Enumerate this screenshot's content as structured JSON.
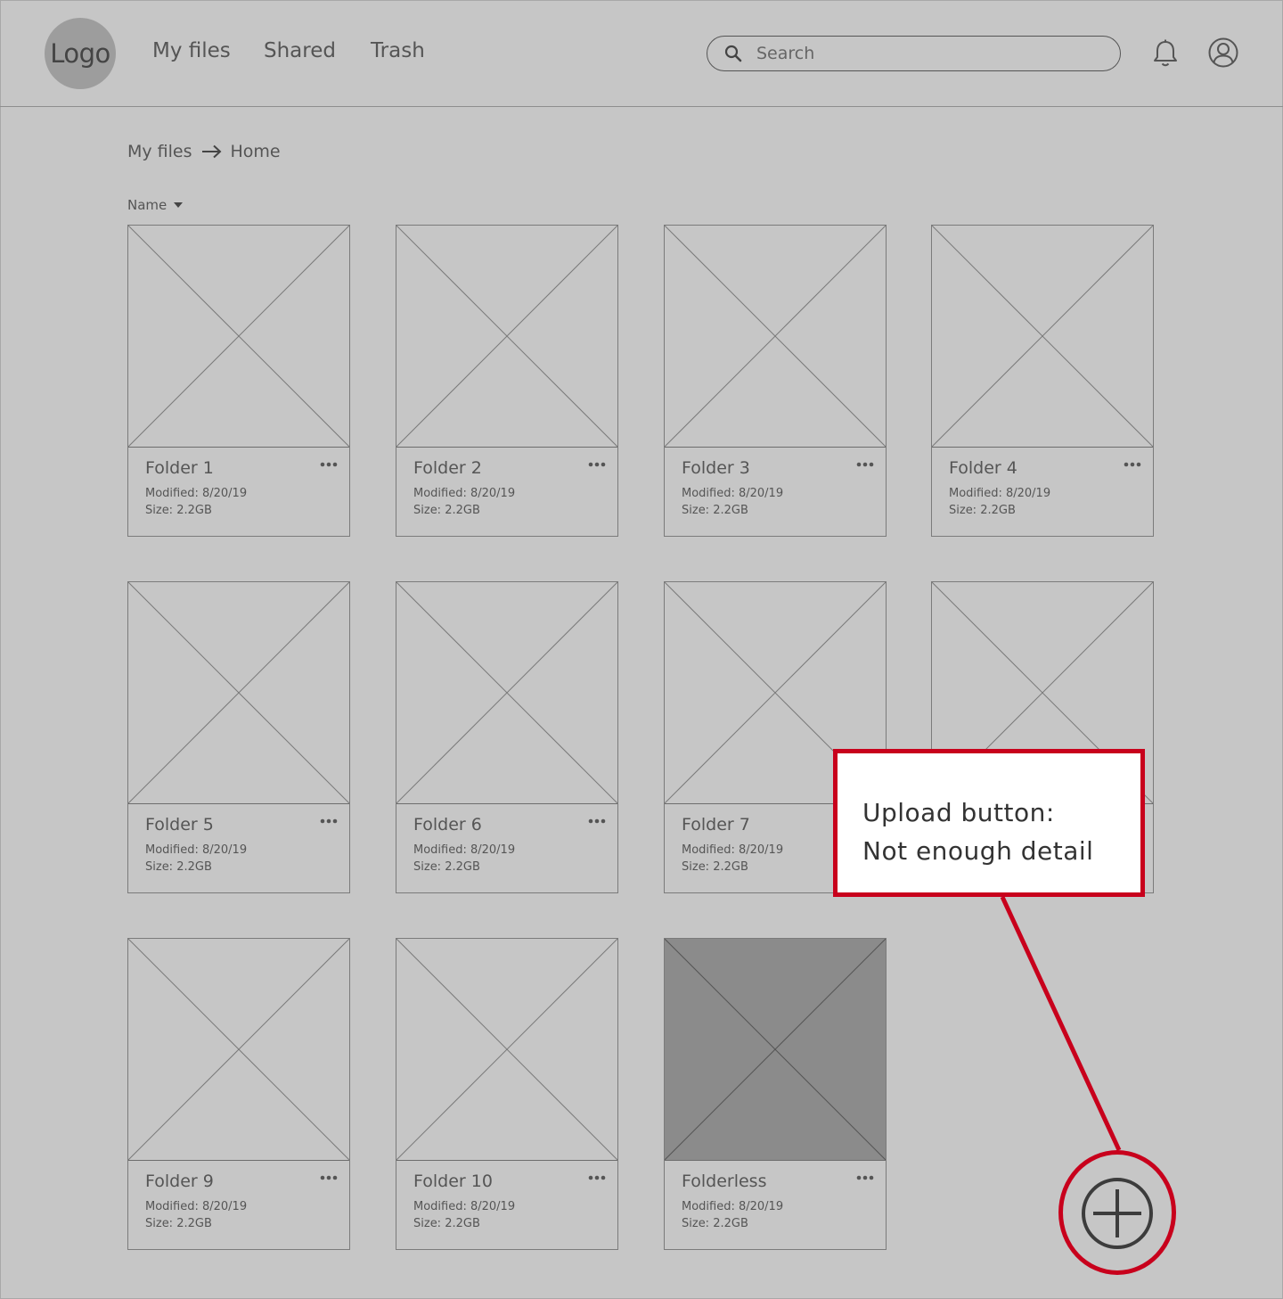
{
  "header": {
    "logo_label": "Logo",
    "nav": [
      {
        "label": "My files"
      },
      {
        "label": "Shared"
      },
      {
        "label": "Trash"
      }
    ],
    "search": {
      "placeholder": "Search",
      "value": ""
    },
    "icons": {
      "search": "search-icon",
      "notifications": "bell-icon",
      "account": "user-icon"
    }
  },
  "breadcrumb": {
    "items": [
      "My files",
      "Home"
    ],
    "separator_icon": "arrow-right-icon"
  },
  "sort": {
    "label": "Name",
    "icon": "caret-down-icon"
  },
  "folders": [
    {
      "name": "Folder 1",
      "modified": "Modified: 8/20/19",
      "size": "Size: 2.2GB"
    },
    {
      "name": "Folder 2",
      "modified": "Modified: 8/20/19",
      "size": "Size: 2.2GB"
    },
    {
      "name": "Folder 3",
      "modified": "Modified: 8/20/19",
      "size": "Size: 2.2GB"
    },
    {
      "name": "Folder 4",
      "modified": "Modified: 8/20/19",
      "size": "Size: 2.2GB"
    },
    {
      "name": "Folder 5",
      "modified": "Modified: 8/20/19",
      "size": "Size: 2.2GB"
    },
    {
      "name": "Folder 6",
      "modified": "Modified: 8/20/19",
      "size": "Size: 2.2GB"
    },
    {
      "name": "Folder 7",
      "modified": "Modified: 8/20/19",
      "size": "Size: 2.2GB"
    },
    {
      "name": "",
      "modified": "",
      "size": ""
    },
    {
      "name": "Folder 9",
      "modified": "Modified: 8/20/19",
      "size": "Size: 2.2GB"
    },
    {
      "name": "Folder 10",
      "modified": "Modified: 8/20/19",
      "size": "Size: 2.2GB"
    },
    {
      "name": "Folderless",
      "modified": "Modified: 8/20/19",
      "size": "Size: 2.2GB",
      "selected": true
    }
  ],
  "annotation": {
    "lines": [
      "Upload button:",
      "Not enough detail"
    ],
    "color": "#c8001c"
  },
  "upload_button": {
    "icon": "plus-circle-icon"
  },
  "colors": {
    "background": "#c6c6c6",
    "text": "#555555",
    "selected_thumb": "#8b8b8b",
    "annotation_red": "#c8001c"
  }
}
